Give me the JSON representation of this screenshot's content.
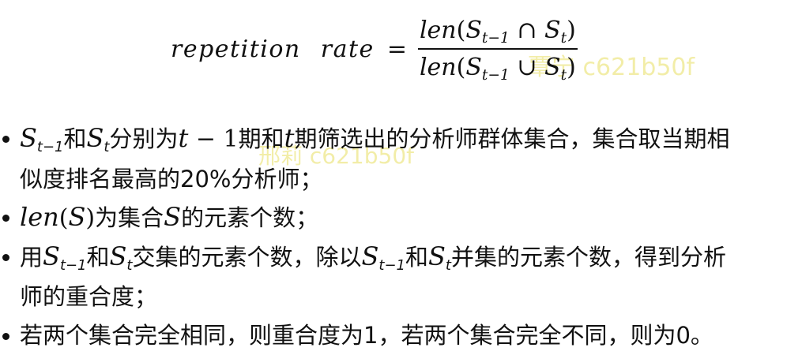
{
  "formula": {
    "lhs": "repetition  rate",
    "equals": "=",
    "numerator": {
      "fn": "len",
      "open": "(",
      "s1": "S",
      "s1_sub": "t−1",
      "op": "∩",
      "s2": "S",
      "s2_sub": "t",
      "close": ")"
    },
    "denominator": {
      "fn": "len",
      "open": "(",
      "s1": "S",
      "s1_sub": "t−1",
      "op": "∪",
      "s2": "S",
      "s2_sub": "t",
      "close": ")"
    }
  },
  "bullets": [
    {
      "lines": [
        "S_{t−1}和S_t分别为t − 1期和t期筛选出的分析师群体集合，集合取当期相",
        "似度排名最高的20%分析师；"
      ],
      "parts": {
        "s1": "S",
        "s1_sub": "t−1",
        "and": "和",
        "s2": "S",
        "s2_sub": "t",
        "t1": "分别为",
        "t_var": "t",
        "minus": " − ",
        "one": "1",
        "t2": "期和",
        "t_var2": "t",
        "t3": "期筛选出的分析师群体集合，集合取当期相",
        "line2": "似度排名最高的20%分析师；"
      }
    },
    {
      "lines": [
        "len(S)为集合S的元素个数；"
      ],
      "parts": {
        "fn": "len",
        "open": "(",
        "s": "S",
        "close": ")",
        "t1": "为集合",
        "s2": "S",
        "t2": "的元素个数；"
      }
    },
    {
      "lines": [
        "用S_{t−1}和S_t交集的元素个数，除以S_{t−1}和S_t并集的元素个数，得到分析",
        "师的重合度；"
      ],
      "parts": {
        "t0": "用",
        "s1": "S",
        "s1_sub": "t−1",
        "and": "和",
        "s2": "S",
        "s2_sub": "t",
        "t1": "交集的元素个数，除以",
        "s3": "S",
        "s3_sub": "t−1",
        "and2": "和",
        "s4": "S",
        "s4_sub": "t",
        "t2": "并集的元素个数，得到分析",
        "line2": "师的重合度；"
      }
    },
    {
      "lines": [
        "若两个集合完全相同，则重合度为1，若两个集合完全不同，则为0。"
      ],
      "parts": {
        "t1": "若两个集合完全相同，则重合度为1，若两个集合完全不同，则为0。"
      }
    }
  ],
  "watermarks": {
    "wm1": "覃宁 c621b50f",
    "wm2": "邢莉 c621b50f"
  },
  "colors": {
    "text": "#111111",
    "watermark": "#f1ec9f",
    "background": "#ffffff"
  }
}
